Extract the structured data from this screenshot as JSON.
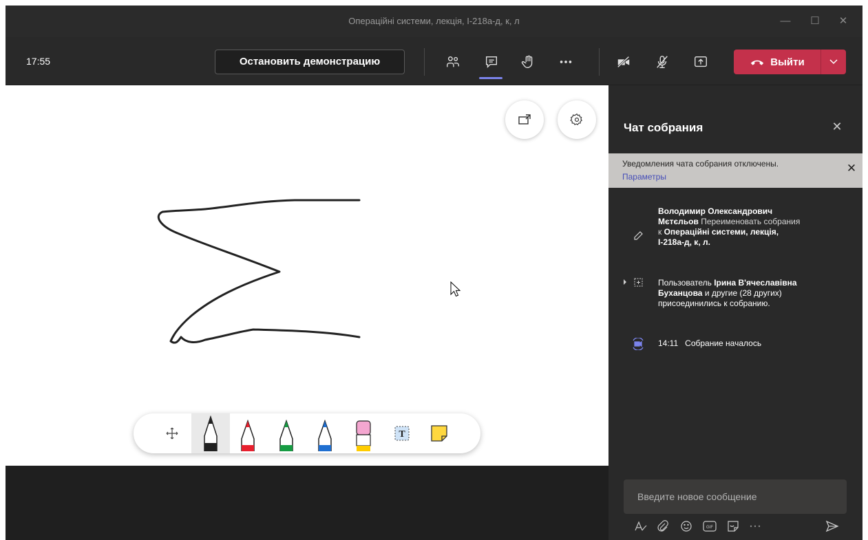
{
  "window": {
    "title": "Операційні системи, лекція, І-218а-д, к, л",
    "minimize_icon": "minimize-icon",
    "maximize_icon": "maximize-icon",
    "close_icon": "close-icon"
  },
  "toolbar": {
    "time": "17:55",
    "stop_sharing_label": "Остановить демонстрацию",
    "leave_label": "Выйти",
    "icons": [
      "participants-icon",
      "chat-icon",
      "raise-hand-icon",
      "more-icon",
      "camera-off-icon",
      "mic-off-icon",
      "share-tray-icon",
      "phone-hangup-icon",
      "chevron-down-icon"
    ],
    "leave_color": "#c4314b",
    "active_indicator_color": "#7b83eb"
  },
  "whiteboard": {
    "popout_icon": "popout-icon",
    "settings_icon": "gear-icon",
    "ink_tools": [
      {
        "name": "pan-tool",
        "icon": "move-icon"
      },
      {
        "name": "black-pen",
        "icon": "pen-icon",
        "color": "#202020",
        "selected": true
      },
      {
        "name": "red-pen",
        "icon": "pen-icon",
        "color": "#e8202e"
      },
      {
        "name": "green-pen",
        "icon": "pen-icon",
        "color": "#169c43"
      },
      {
        "name": "blue-pen",
        "icon": "pen-icon",
        "color": "#1f6fd1"
      },
      {
        "name": "highlighter",
        "icon": "highlighter-icon",
        "color": "#ffcc00"
      },
      {
        "name": "text-tool",
        "icon": "text-icon",
        "glyph": "T"
      },
      {
        "name": "sticky-note",
        "icon": "sticky-note-icon",
        "color": "#ffd83f"
      }
    ]
  },
  "chat": {
    "title": "Чат собрания",
    "notice_text": "Уведомления чата собрания отключены.",
    "notice_link": "Параметры",
    "events": {
      "rename_actor": "Володимир Олександрович Мєтєльов",
      "rename_text": "Переименовать собрания к",
      "rename_name": "Операційні системи, лекція, І-218а-д, к, л.",
      "join_prefix": "Пользователь",
      "join_user": "Ірина В'ячеславівна Буханцова",
      "join_and": "и",
      "join_others": "другие (28 других)",
      "join_suffix": "присоединились к собранию.",
      "start_time": "14:11",
      "start_text": "Собрание началось"
    },
    "compose_placeholder": "Введите новое сообщение",
    "compose_icons": [
      "format-icon",
      "attach-icon",
      "emoji-icon",
      "gif-icon",
      "sticker-icon",
      "more-icon",
      "send-icon"
    ]
  }
}
